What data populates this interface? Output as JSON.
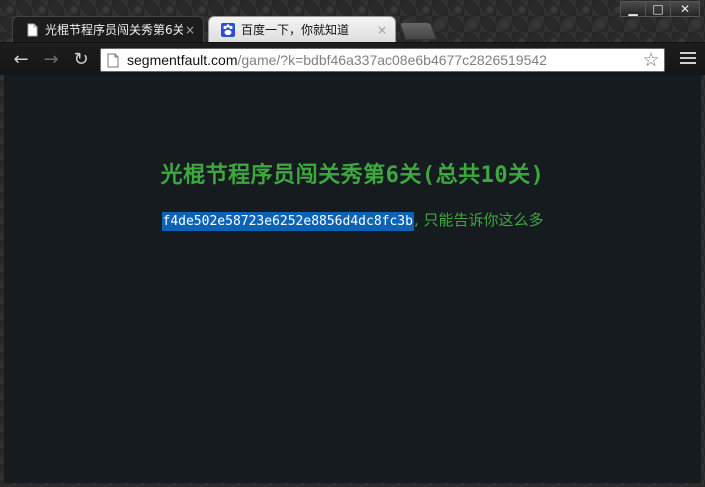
{
  "window": {
    "controls": {
      "minimize": "▁",
      "maximize": "□",
      "close": "✕"
    }
  },
  "tabs": [
    {
      "title": "光棍节程序员闯关秀第6关",
      "icon": "document-icon",
      "close": "×",
      "active": true
    },
    {
      "title": "百度一下，你就知道",
      "icon": "baidu-paw-icon",
      "close": "×",
      "active": false
    }
  ],
  "toolbar": {
    "back": "←",
    "forward": "→",
    "reload": "↻",
    "url_host": "segmentfault.com",
    "url_path": "/game/?k=bdbf46a337ac08e6b4677c2826519542",
    "bookmark": "☆"
  },
  "page": {
    "title": "光棍节程序员闯关秀第6关(总共10关)",
    "answer_code": "f4de502e58723e6252e8856d4dc8fc3b",
    "answer_suffix": ", 只能告诉你这么多"
  },
  "colors": {
    "page_background": "#161b20",
    "text_green": "#3da83d",
    "selection_blue": "#0b63b8",
    "chrome_dark": "#1c1c1c"
  }
}
